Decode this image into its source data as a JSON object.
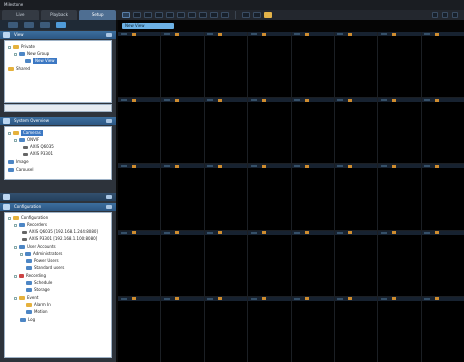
{
  "app": {
    "title": "Milestone"
  },
  "tabs": [
    {
      "label": "Live",
      "active": false
    },
    {
      "label": "Playback",
      "active": false
    },
    {
      "label": "Setup",
      "active": true
    }
  ],
  "view_panel": {
    "header": "View"
  },
  "view_tree": {
    "private": "Private",
    "new_group": "New Group",
    "new_view": "New View",
    "shared": "Shared"
  },
  "system_overview": {
    "header": "System Overview",
    "items": [
      {
        "label": "Cameras",
        "selected": true
      },
      {
        "label": "ONVIF",
        "selected": false
      },
      {
        "label": "AXIS Q6035",
        "selected": false
      },
      {
        "label": "AXIS P3301",
        "selected": false
      },
      {
        "label": "Image",
        "selected": false
      },
      {
        "label": "Carousel",
        "selected": false
      }
    ]
  },
  "configuration": {
    "header": "Configuration",
    "items": [
      "Configuration",
      "Recorders",
      "AXIS Q6035 [192.168.1.244:8080]",
      "AXIS P3301 [192.168.1.100:8080]",
      "User Accounts",
      "Administrators",
      "Power Users",
      "Standard users",
      "Recording",
      "Schedule",
      "Storage",
      "Event",
      "Alarm In",
      "Motion",
      "Log"
    ]
  },
  "main": {
    "view_tab": "New View",
    "rows": 5,
    "cols": 8
  },
  "colors": {
    "accent": "#4e6e92",
    "panel_header": "#2c5783",
    "selection": "#3c78c3",
    "cell_marker": "#ce8c2f"
  }
}
